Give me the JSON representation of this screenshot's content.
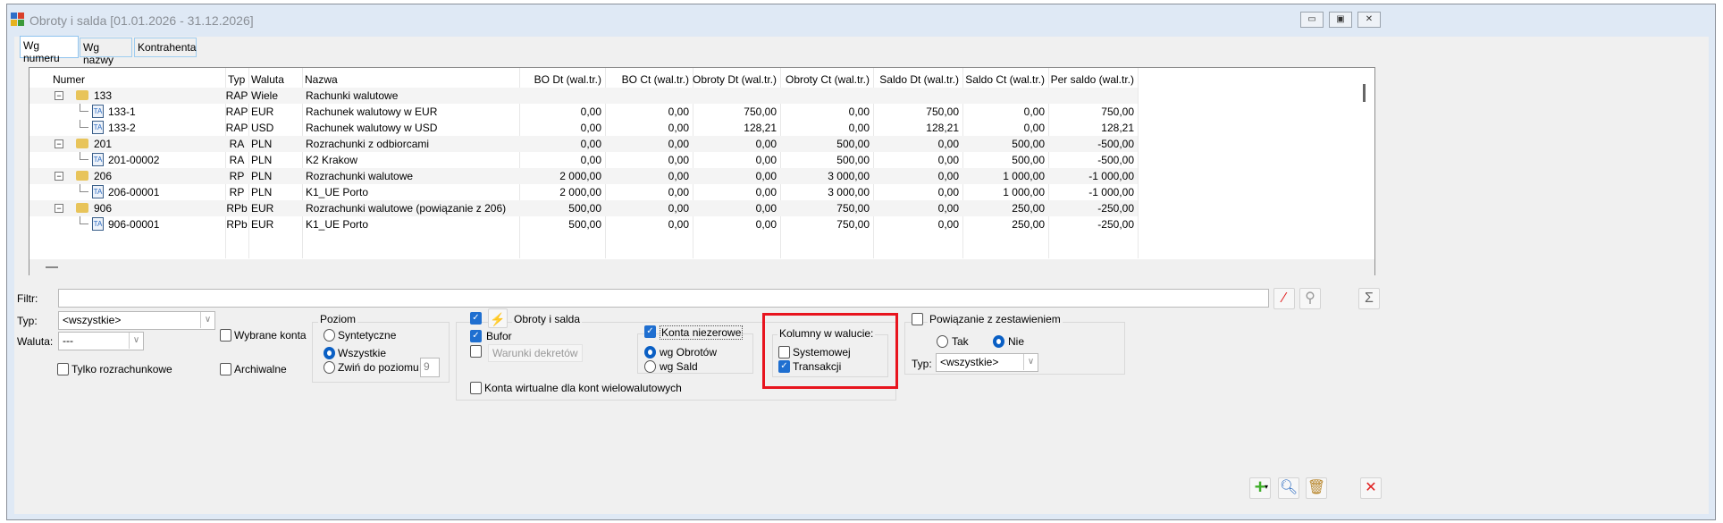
{
  "window": {
    "title": "Obroty i salda [01.01.2026 - 31.12.2026]",
    "minimize": "▭",
    "restore": "▣",
    "close": "✕"
  },
  "tabs": [
    "Wg numeru",
    "Wg nazwy",
    "Kontrahenta"
  ],
  "columns": [
    "Numer",
    "Typ",
    "Waluta",
    "Nazwa",
    "BO Dt (wal.tr.)",
    "BO Ct (wal.tr.)",
    "Obroty Dt (wal.tr.)",
    "Obroty Ct (wal.tr.)",
    "Saldo Dt (wal.tr.)",
    "Saldo Ct (wal.tr.)",
    "Per saldo (wal.tr.)"
  ],
  "rows": [
    {
      "num": "133",
      "typ": "RAP",
      "wal": "Wiele",
      "nazwa": "Rachunki walutowe",
      "v": [
        "",
        "",
        "",
        "",
        "",
        "",
        ""
      ],
      "group": true
    },
    {
      "num": "133-1",
      "typ": "RAP",
      "wal": "EUR",
      "nazwa": "Rachunek walutowy w EUR",
      "v": [
        "0,00",
        "0,00",
        "750,00",
        "0,00",
        "750,00",
        "0,00",
        "750,00"
      ]
    },
    {
      "num": "133-2",
      "typ": "RAP",
      "wal": "USD",
      "nazwa": "Rachunek walutowy w USD",
      "v": [
        "0,00",
        "0,00",
        "128,21",
        "0,00",
        "128,21",
        "0,00",
        "128,21"
      ]
    },
    {
      "num": "201",
      "typ": "RA",
      "wal": "PLN",
      "nazwa": "Rozrachunki z odbiorcami",
      "v": [
        "0,00",
        "0,00",
        "0,00",
        "500,00",
        "0,00",
        "500,00",
        "-500,00"
      ],
      "group": true
    },
    {
      "num": "201-00002",
      "typ": "RA",
      "wal": "PLN",
      "nazwa": "K2 Krakow",
      "v": [
        "0,00",
        "0,00",
        "0,00",
        "500,00",
        "0,00",
        "500,00",
        "-500,00"
      ]
    },
    {
      "num": "206",
      "typ": "RP",
      "wal": "PLN",
      "nazwa": "Rozrachunki walutowe",
      "v": [
        "2 000,00",
        "0,00",
        "0,00",
        "3 000,00",
        "0,00",
        "1 000,00",
        "-1 000,00"
      ],
      "group": true
    },
    {
      "num": "206-00001",
      "typ": "RP",
      "wal": "PLN",
      "nazwa": "K1_UE Porto",
      "v": [
        "2 000,00",
        "0,00",
        "0,00",
        "3 000,00",
        "0,00",
        "1 000,00",
        "-1 000,00"
      ]
    },
    {
      "num": "906",
      "typ": "RPb",
      "wal": "EUR",
      "nazwa": "Rozrachunki walutowe (powiązanie z 206)",
      "v": [
        "500,00",
        "0,00",
        "0,00",
        "750,00",
        "0,00",
        "250,00",
        "-250,00"
      ],
      "group": true
    },
    {
      "num": "906-00001",
      "typ": "RPb",
      "wal": "EUR",
      "nazwa": "K1_UE Porto",
      "v": [
        "500,00",
        "0,00",
        "0,00",
        "750,00",
        "0,00",
        "250,00",
        "-250,00"
      ]
    }
  ],
  "filters": {
    "filtr_label": "Filtr:",
    "filtr_value": "",
    "typ_label": "Typ:",
    "typ_value": "<wszystkie>",
    "waluta_label": "Waluta:",
    "waluta_value": "---",
    "wybrane_konta": "Wybrane konta",
    "archiwalne": "Archiwalne",
    "tylko_rozrachunkowe": "Tylko rozrachunkowe",
    "poziom_label": "Poziom",
    "syntetyczne": "Syntetyczne",
    "wszystkie": "Wszystkie",
    "zwin": "Zwiń do poziomu",
    "poziom_value": "9",
    "obroty_salda": "Obroty i salda",
    "bufor": "Bufor",
    "warunki": "Warunki dekretów",
    "konta_niezerowe": "Konta niezerowe",
    "wg_obrotow": "wg Obrotów",
    "wg_sald": "wg Sald",
    "konta_wirtualne": "Konta wirtualne dla kont wielowalutowych",
    "kolumny_label": "Kolumny w walucie:",
    "systemowej": "Systemowej",
    "transakcji": "Transakcji",
    "powiazanie": "Powiązanie z zestawieniem",
    "tak": "Tak",
    "nie": "Nie",
    "typ2_label": "Typ:",
    "typ2_value": "<wszystkie>"
  },
  "colors": {
    "accent": "#1f6fd0",
    "highlight": "#e8141e"
  }
}
